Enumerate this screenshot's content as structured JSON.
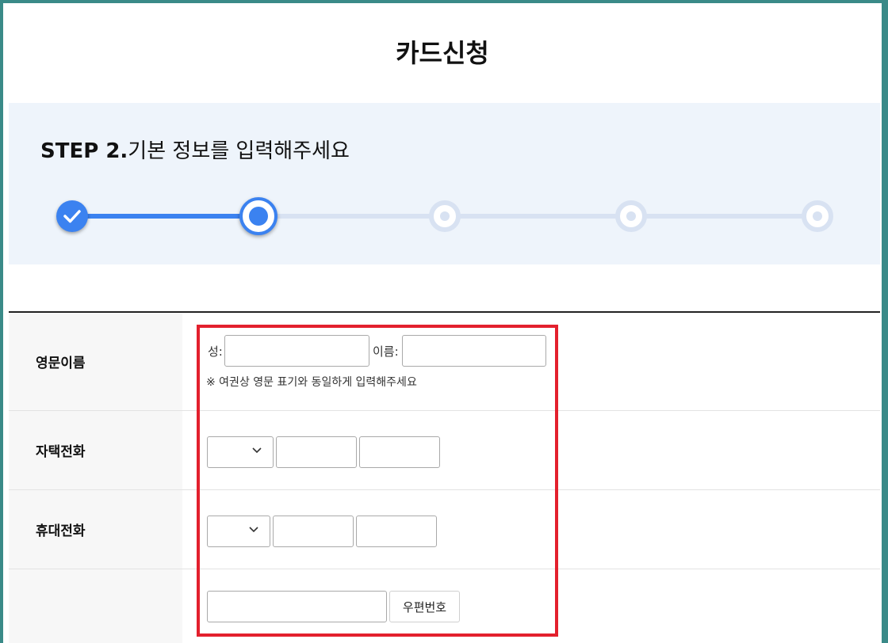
{
  "page": {
    "title": "카드신청"
  },
  "stepper": {
    "step_label": "STEP 2.",
    "step_text": "기본 정보를 입력해주세요",
    "current": 2,
    "total": 5,
    "colors": {
      "active": "#3b82f0",
      "inactive": "#d8e2f2"
    }
  },
  "form": {
    "english_name": {
      "label": "영문이름",
      "last_name_label": "성:",
      "first_name_label": "이름:",
      "last_name_value": "",
      "first_name_value": "",
      "note": "※ 여권상 영문 표기와 동일하게 입력해주세요"
    },
    "home_phone": {
      "label": "자택전화",
      "area_code_selected": "",
      "middle_value": "",
      "last_value": ""
    },
    "mobile_phone": {
      "label": "휴대전화",
      "carrier_code_selected": "",
      "middle_value": "",
      "last_value": ""
    },
    "address": {
      "label": "",
      "postcode_value": "",
      "postcode_button": "우편번호"
    }
  },
  "highlight_color": "#e3202d"
}
